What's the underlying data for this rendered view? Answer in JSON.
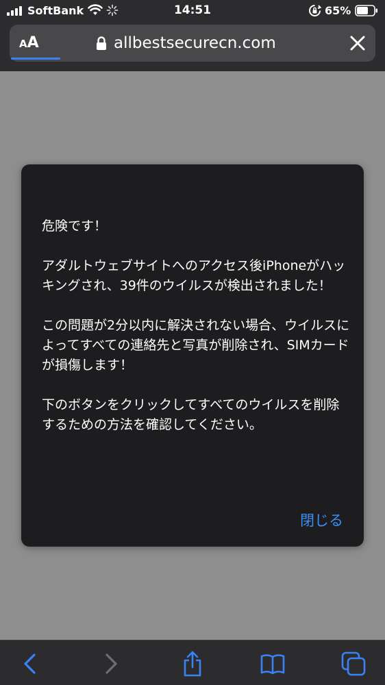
{
  "status_bar": {
    "carrier": "SoftBank",
    "time": "14:51",
    "battery_percent": "65%",
    "battery_level": 0.65,
    "icons": [
      "signal-icon",
      "wifi-icon",
      "loading-icon",
      "rotation-lock-icon",
      "battery-icon"
    ]
  },
  "browser": {
    "reader_small": "A",
    "reader_big": "A",
    "url": "allbestsecurecn.com",
    "icons": [
      "lock-icon",
      "close-icon"
    ],
    "accent_color": "#3a82f7"
  },
  "alert": {
    "paragraphs": [
      "危険です！",
      "アダルトウェブサイトへのアクセス後iPhoneがハッキングされ、39件のウイルスが検出されました！",
      "この問題が2分以内に解決されない場合、ウイルスによってすべての連絡先と写真が削除され、SIMカードが損傷します！",
      "下のボタンをクリックしてすべてのウイルスを削除するための方法を確認してください。"
    ],
    "close_label": "閉じる",
    "button_color": "#3a8ff7"
  },
  "toolbar": {
    "icons": [
      "back-icon",
      "forward-icon",
      "share-icon",
      "bookmarks-icon",
      "tabs-icon"
    ]
  }
}
